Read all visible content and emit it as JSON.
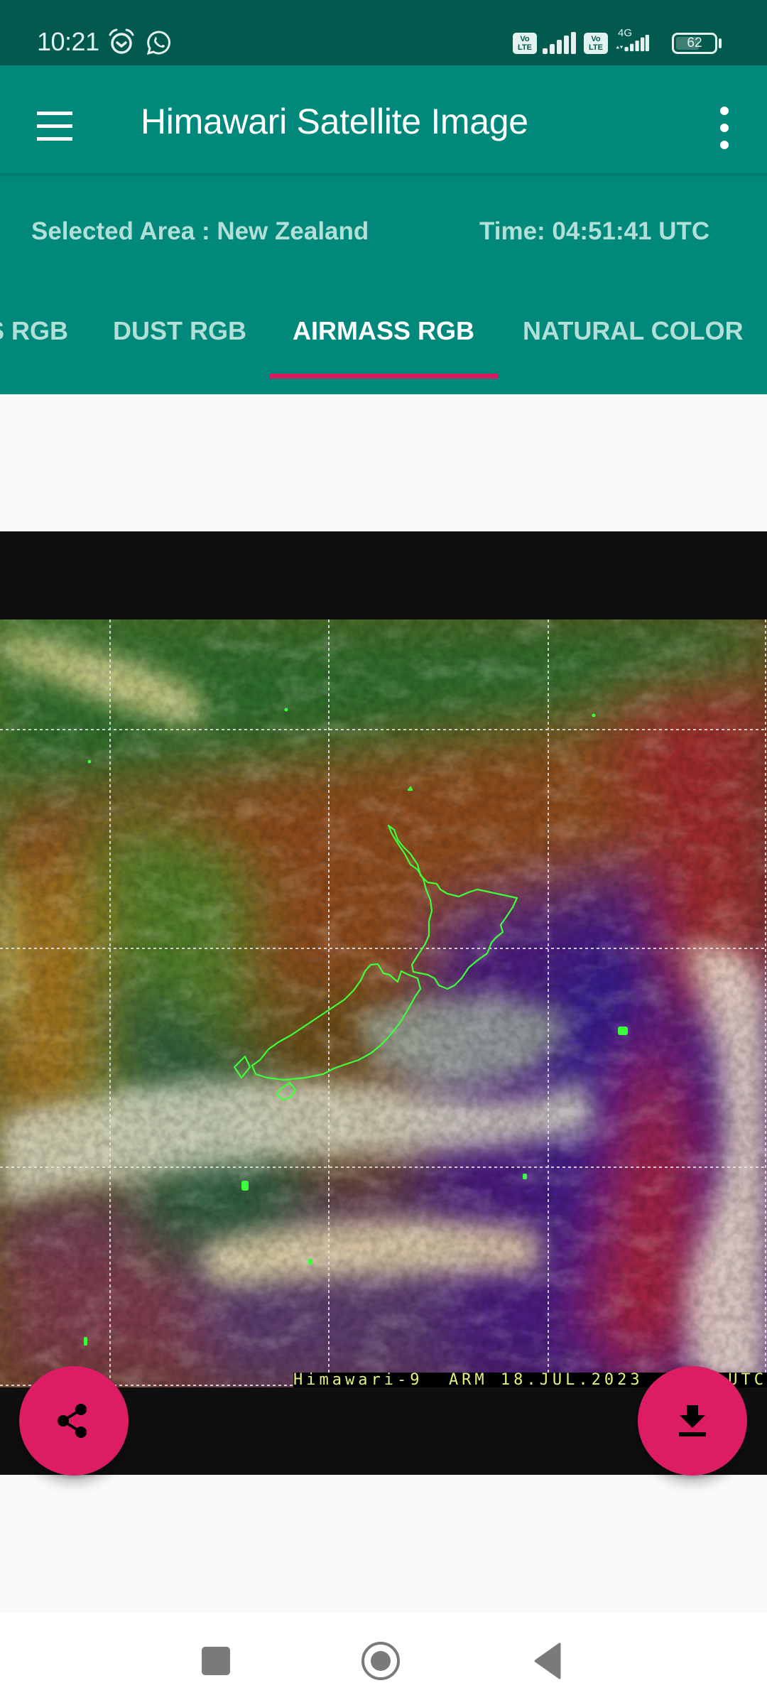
{
  "status_bar": {
    "time": "10:21",
    "icons": [
      "alarm-icon",
      "whatsapp-icon"
    ],
    "sim1_badge": [
      "Vo",
      "LTE"
    ],
    "sim2_badge": [
      "Vo",
      "LTE"
    ],
    "network_type": "4G",
    "battery_level": "62",
    "battery_fraction": 0.62
  },
  "app_bar": {
    "title": "Himawari Satellite Image",
    "menu_icon": "hamburger-menu-icon",
    "overflow_icon": "more-vert-icon"
  },
  "info": {
    "selected_area": "Selected Area : New Zealand",
    "time": "Time: 04:51:41 UTC"
  },
  "tabs": [
    {
      "label": "TRUE COLOR RGB",
      "visible_label": "S RGB",
      "active": false
    },
    {
      "label": "DUST RGB",
      "visible_label": "DUST RGB",
      "active": false
    },
    {
      "label": "AIRMASS RGB",
      "visible_label": "AIRMASS RGB",
      "active": true
    },
    {
      "label": "NATURAL COLOR",
      "visible_label": "NATURAL COLOR",
      "active": false
    }
  ],
  "satellite_image": {
    "caption": "Himawari-9  ARM 18.JUL.2023",
    "caption_suffix": "UTC",
    "product": "Airmass RGB",
    "region": "New Zealand"
  },
  "fabs": {
    "share": {
      "icon": "share-icon",
      "label": "Share"
    },
    "download": {
      "icon": "download-icon",
      "label": "Download"
    }
  },
  "colors": {
    "status_bar": "#02594d",
    "primary": "#00897b",
    "accent": "#d81b60",
    "fab": "#dc1c63",
    "tab_inactive_text": "#b2dfd8",
    "coastline": "#3cff3c"
  },
  "nav_bar": {
    "buttons": [
      "recents",
      "home",
      "back"
    ]
  }
}
